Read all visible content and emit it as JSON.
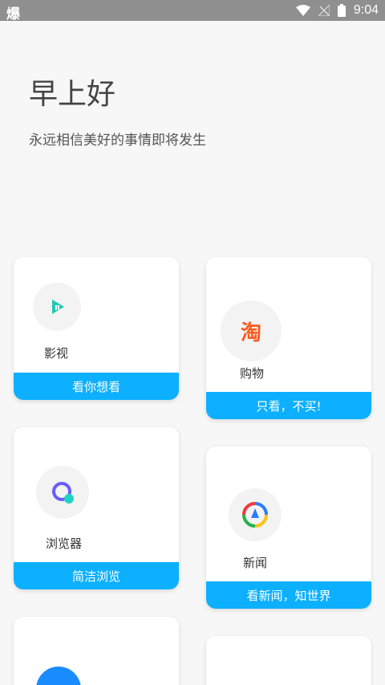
{
  "status": {
    "app_glyph": "爆",
    "time": "9:04",
    "icons": [
      "wifi-icon",
      "no-signal-icon",
      "battery-icon"
    ]
  },
  "header": {
    "greeting": "早上好",
    "motto": "永远相信美好的事情即将发生"
  },
  "cards": [
    {
      "id": "video",
      "label": "影视",
      "footer": "看你想看",
      "icon": "play-icon",
      "accent": "#1fc8b8"
    },
    {
      "id": "shopping",
      "label": "购物",
      "footer": "只看，不买!",
      "icon": "taobao-icon",
      "icon_text": "淘",
      "accent": "#ff5a1f"
    },
    {
      "id": "browser",
      "label": "浏览器",
      "footer": "简洁浏览",
      "icon": "browser-icon",
      "accent": "#6a5cff"
    },
    {
      "id": "news",
      "label": "新闻",
      "footer": "看新闻，知世界",
      "icon": "news-icon",
      "accent": "#2a7dff"
    }
  ],
  "colors": {
    "footer_bg": "#0db0ff",
    "status_bg": "#8f8f8f",
    "page_bg": "#f7f7f7"
  }
}
